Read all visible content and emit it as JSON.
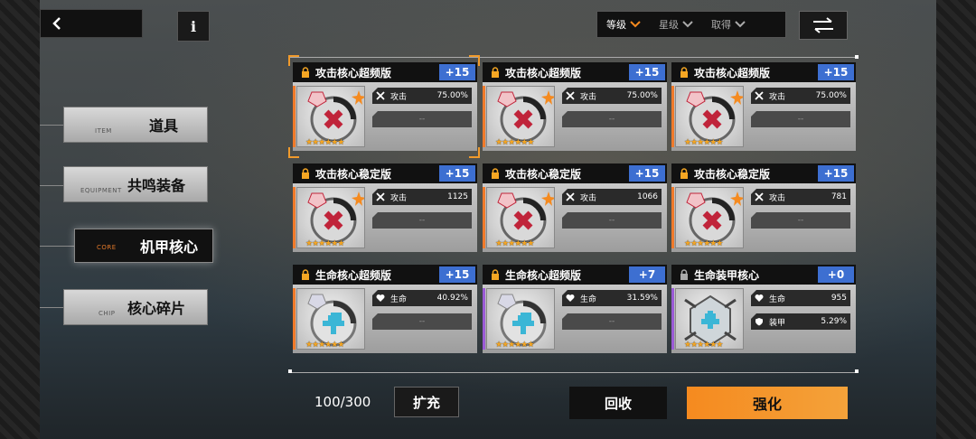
{
  "nav": {
    "items": [
      {
        "label": "道具",
        "sub": "ITEM",
        "active": false
      },
      {
        "label": "共鸣装备",
        "sub": "EQUIPMENT",
        "active": false
      },
      {
        "label": "机甲核心",
        "sub": "CORE",
        "active": true
      },
      {
        "label": "核心碎片",
        "sub": "CHIP",
        "active": false
      }
    ]
  },
  "info_label": "i",
  "filters": {
    "level": "等级",
    "star": "星级",
    "obtain": "取得"
  },
  "cards": [
    {
      "title": "攻击核心超频版",
      "plus": "+15",
      "stat1_name": "攻击",
      "stat1_value": "75.00%",
      "stat2": "--",
      "edge_color": "#f07a2a",
      "icon": "attack"
    },
    {
      "title": "攻击核心超频版",
      "plus": "+15",
      "stat1_name": "攻击",
      "stat1_value": "75.00%",
      "stat2": "--",
      "edge_color": "#f07a2a",
      "icon": "attack"
    },
    {
      "title": "攻击核心超频版",
      "plus": "+15",
      "stat1_name": "攻击",
      "stat1_value": "75.00%",
      "stat2": "--",
      "edge_color": "#f07a2a",
      "icon": "attack"
    },
    {
      "title": "攻击核心稳定版",
      "plus": "+15",
      "stat1_name": "攻击",
      "stat1_value": "1125",
      "stat2": "--",
      "edge_color": "#f07a2a",
      "icon": "attack"
    },
    {
      "title": "攻击核心稳定版",
      "plus": "+15",
      "stat1_name": "攻击",
      "stat1_value": "1066",
      "stat2": "--",
      "edge_color": "#f07a2a",
      "icon": "attack"
    },
    {
      "title": "攻击核心稳定版",
      "plus": "+15",
      "stat1_name": "攻击",
      "stat1_value": "781",
      "stat2": "--",
      "edge_color": "#f07a2a",
      "icon": "attack"
    },
    {
      "title": "生命核心超频版",
      "plus": "+15",
      "stat1_name": "生命",
      "stat1_value": "40.92%",
      "stat2": "--",
      "edge_color": "#f07a2a",
      "icon": "life"
    },
    {
      "title": "生命核心超频版",
      "plus": "+7",
      "stat1_name": "生命",
      "stat1_value": "31.59%",
      "stat2": "--",
      "edge_color": "#9b5bd6",
      "icon": "life"
    },
    {
      "title": "生命装甲核心",
      "plus": "+0",
      "stat1_name": "生命",
      "stat1_value": "955",
      "stat2_name": "装甲",
      "stat2_value": "5.29%",
      "edge_color": "#9b5bd6",
      "icon": "armor",
      "unlocked": true
    }
  ],
  "capacity": "100/300",
  "buttons": {
    "expand": "扩充",
    "recycle": "回收",
    "enhance": "强化"
  },
  "colors": {
    "accent_orange": "#f58a1f",
    "plus_blue": "#3d6fd1",
    "star": "#f5a623"
  }
}
